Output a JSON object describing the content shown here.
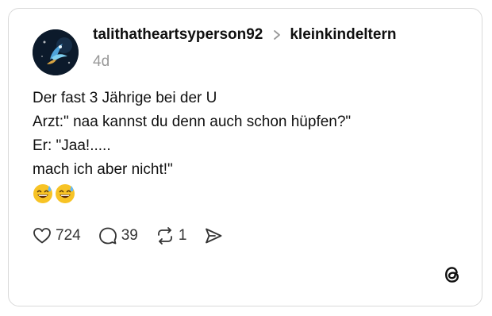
{
  "post": {
    "username": "talithatheartsyperson92",
    "community": "kleinkindeltern",
    "timestamp": "4d",
    "lines": [
      "Der fast 3 Jährige bei der U",
      "Arzt:\" naa kannst du denn auch schon hüpfen?\"",
      "Er: \"Jaa!.....",
      "mach ich aber nicht!\""
    ],
    "emojis": [
      "grinning-face-with-sweat",
      "grinning-face-with-sweat"
    ]
  },
  "actions": {
    "likes": "724",
    "replies": "39",
    "reposts": "1"
  },
  "icons": {
    "like": "heart-icon",
    "reply": "speech-bubble-icon",
    "repost": "repost-icon",
    "share": "send-icon",
    "brand": "threads-logo"
  },
  "colors": {
    "text": "#101010",
    "muted": "#999999",
    "border": "#d9d9d9"
  }
}
